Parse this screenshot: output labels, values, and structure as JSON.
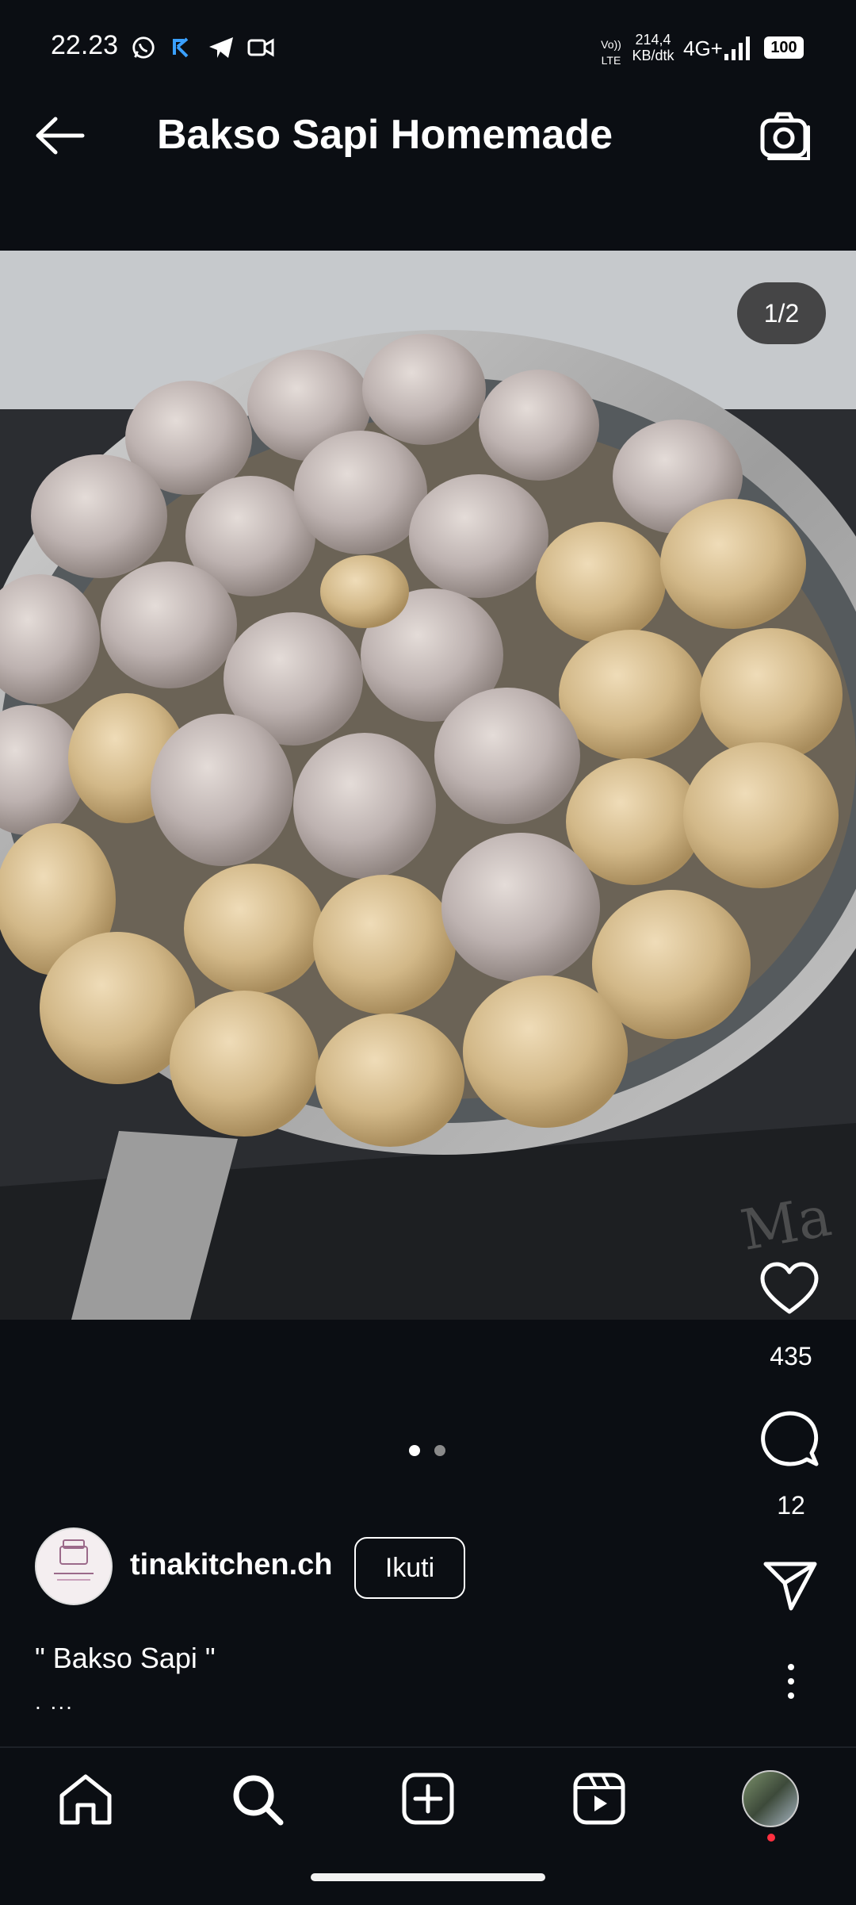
{
  "status_bar": {
    "time": "22.23",
    "volte_top": "Vo))",
    "volte_bottom": "LTE",
    "speed_value": "214,4",
    "speed_unit": "KB/dtk",
    "network": "4G+",
    "battery": "100"
  },
  "header": {
    "title": "Bakso Sapi Homemade"
  },
  "photo": {
    "counter": "1/2",
    "slide_count": 2,
    "active_slide": 1
  },
  "actions": {
    "likes": "435",
    "comments": "12"
  },
  "post": {
    "username": "tinakitchen.ch",
    "follow_label": "Ikuti",
    "caption": "\" Bakso Sapi \"",
    "more": ". ..."
  },
  "colors": {
    "background": "#0b0e13",
    "accent_red": "#ff3040",
    "text": "#ffffff"
  },
  "icons": [
    "back-arrow-icon",
    "camera-icon",
    "heart-icon",
    "comment-icon",
    "send-icon",
    "more-vertical-icon",
    "home-icon",
    "search-icon",
    "create-icon",
    "reels-icon",
    "profile-avatar"
  ]
}
